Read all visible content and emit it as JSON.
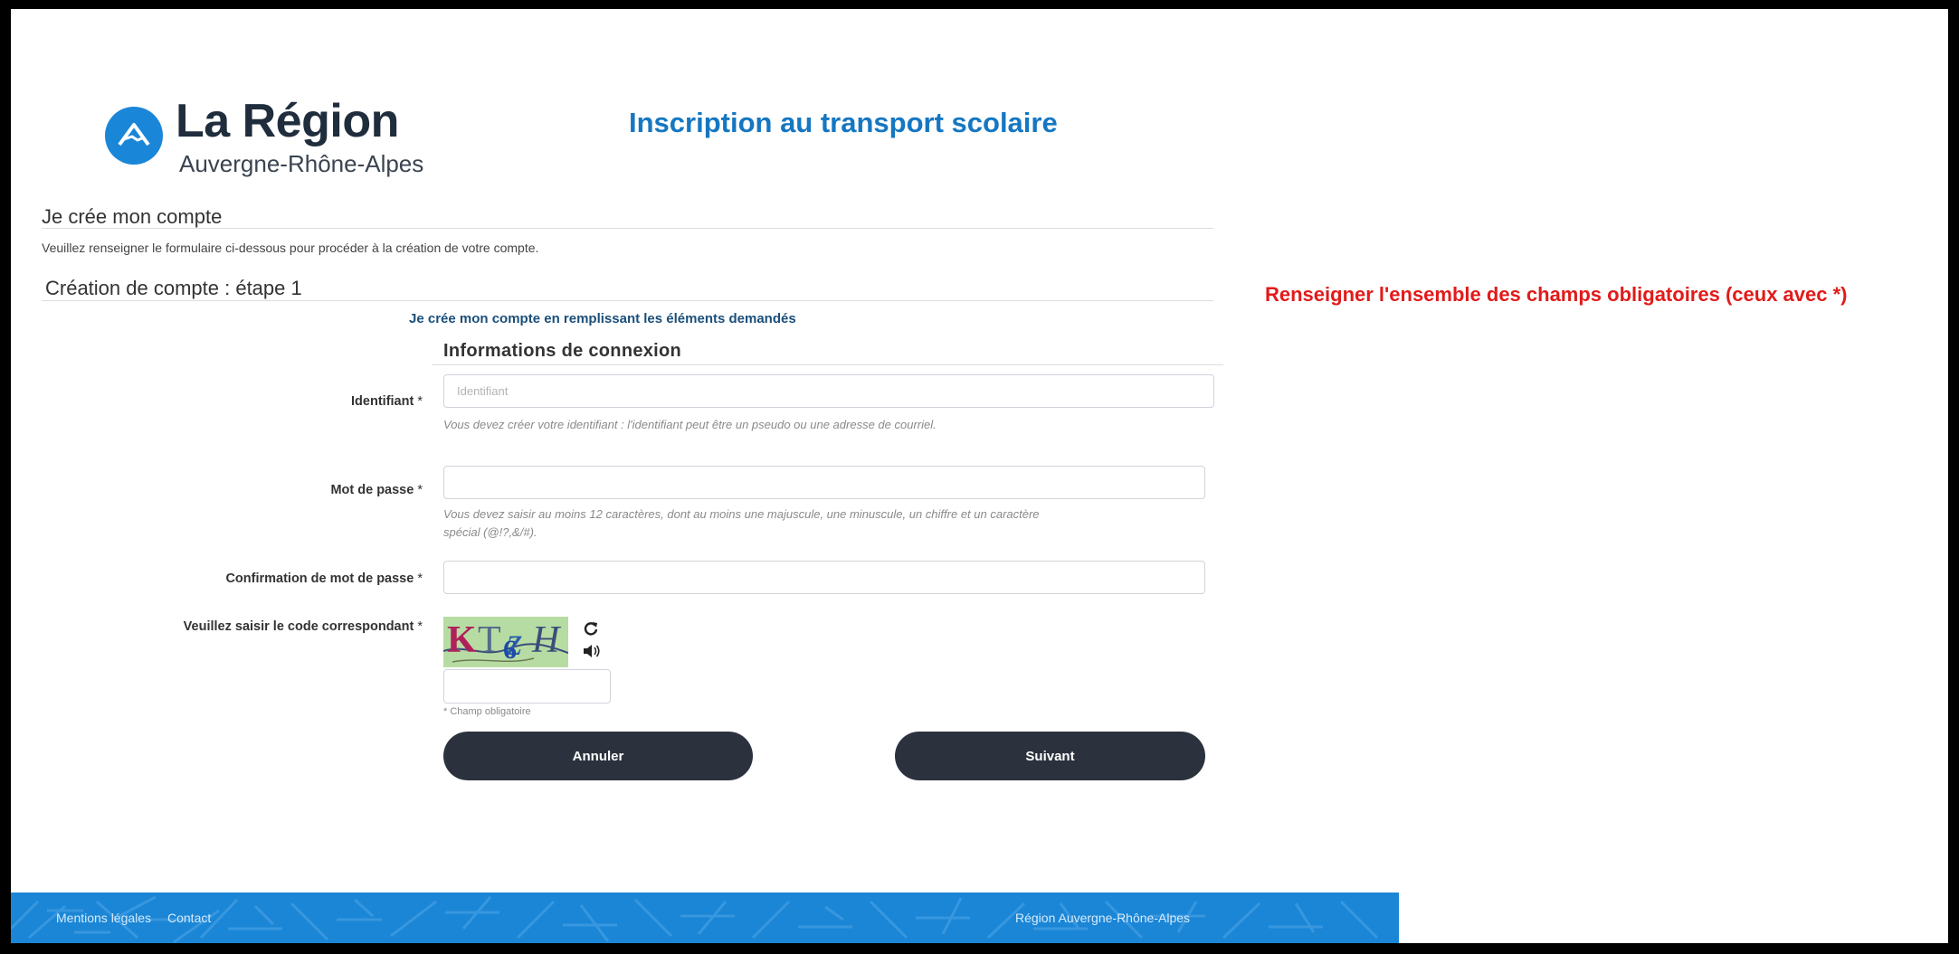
{
  "brand": {
    "name": "La Région",
    "subtitle": "Auvergne-Rhône-Alpes"
  },
  "page": {
    "title": "Inscription au transport scolaire"
  },
  "account": {
    "heading": "Je crée mon compte",
    "intro": "Veuillez renseigner le formulaire ci-dessous pour procéder à la création de votre compte.",
    "step": "Création de compte : étape 1",
    "instruction": "Je crée mon compte en remplissant les éléments demandés",
    "section": "Informations de connexion"
  },
  "notice": "Renseigner l'ensemble des champs obligatoires (ceux avec *)",
  "form": {
    "required_mark": "*",
    "identifiant": {
      "label": "Identifiant",
      "placeholder": "Identifiant",
      "value": "",
      "help": "Vous devez créer votre identifiant : l'identifiant peut être un pseudo ou une adresse de courriel."
    },
    "password": {
      "label": "Mot de passe",
      "value": "",
      "help_line1": "Vous devez saisir au moins 12 caractères, dont au moins une majuscule, une minuscule, un chiffre et un caractère",
      "help_line2": "spécial (@!?,&/#)."
    },
    "password_confirm": {
      "label": "Confirmation de mot de passe",
      "value": ""
    },
    "captcha": {
      "label": "Veuillez saisir le code correspondant",
      "value": "",
      "refresh_icon": "refresh-icon",
      "audio_icon": "speaker-icon"
    },
    "required_note": "* Champ obligatoire"
  },
  "buttons": {
    "cancel": "Annuler",
    "next": "Suivant"
  },
  "footer": {
    "legal": "Mentions légales",
    "contact": "Contact",
    "org": "Région Auvergne-Rhône-Alpes"
  },
  "colors": {
    "brand_blue": "#1a86d8",
    "title_blue": "#1577c2",
    "notice_red": "#e21a1a",
    "button_dark": "#2b323d"
  }
}
